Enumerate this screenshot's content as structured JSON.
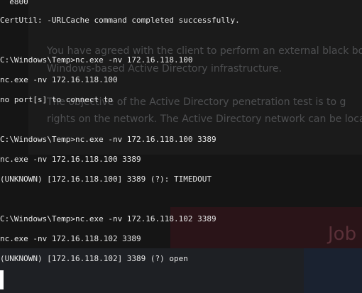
{
  "background_page": {
    "lines": [
      "You have agreed with the client to perform an external black bo",
      "Windows-based Active Directory infrastructure.",
      "The objective of the Active Directory penetration test is to g",
      "rights on the network. The Active Directory network can be loca"
    ],
    "job_label": "Job"
  },
  "terminal": {
    "lines": [
      "  e800",
      "CertUtil: -URLCache command completed successfully.",
      "C:\\Windows\\Temp>nc.exe -nv 172.16.118.100",
      "nc.exe -nv 172.16.118.100",
      "no port[s] to connect to",
      "C:\\Windows\\Temp>nc.exe -nv 172.16.118.100 3389",
      "nc.exe -nv 172.16.118.100 3389",
      "(UNKNOWN) [172.16.118.100] 3389 (?): TIMEDOUT",
      "C:\\Windows\\Temp>nc.exe -nv 172.16.118.102 3389",
      "nc.exe -nv 172.16.118.102 3389",
      "(UNKNOWN) [172.16.118.102] 3389 (?) open"
    ]
  }
}
